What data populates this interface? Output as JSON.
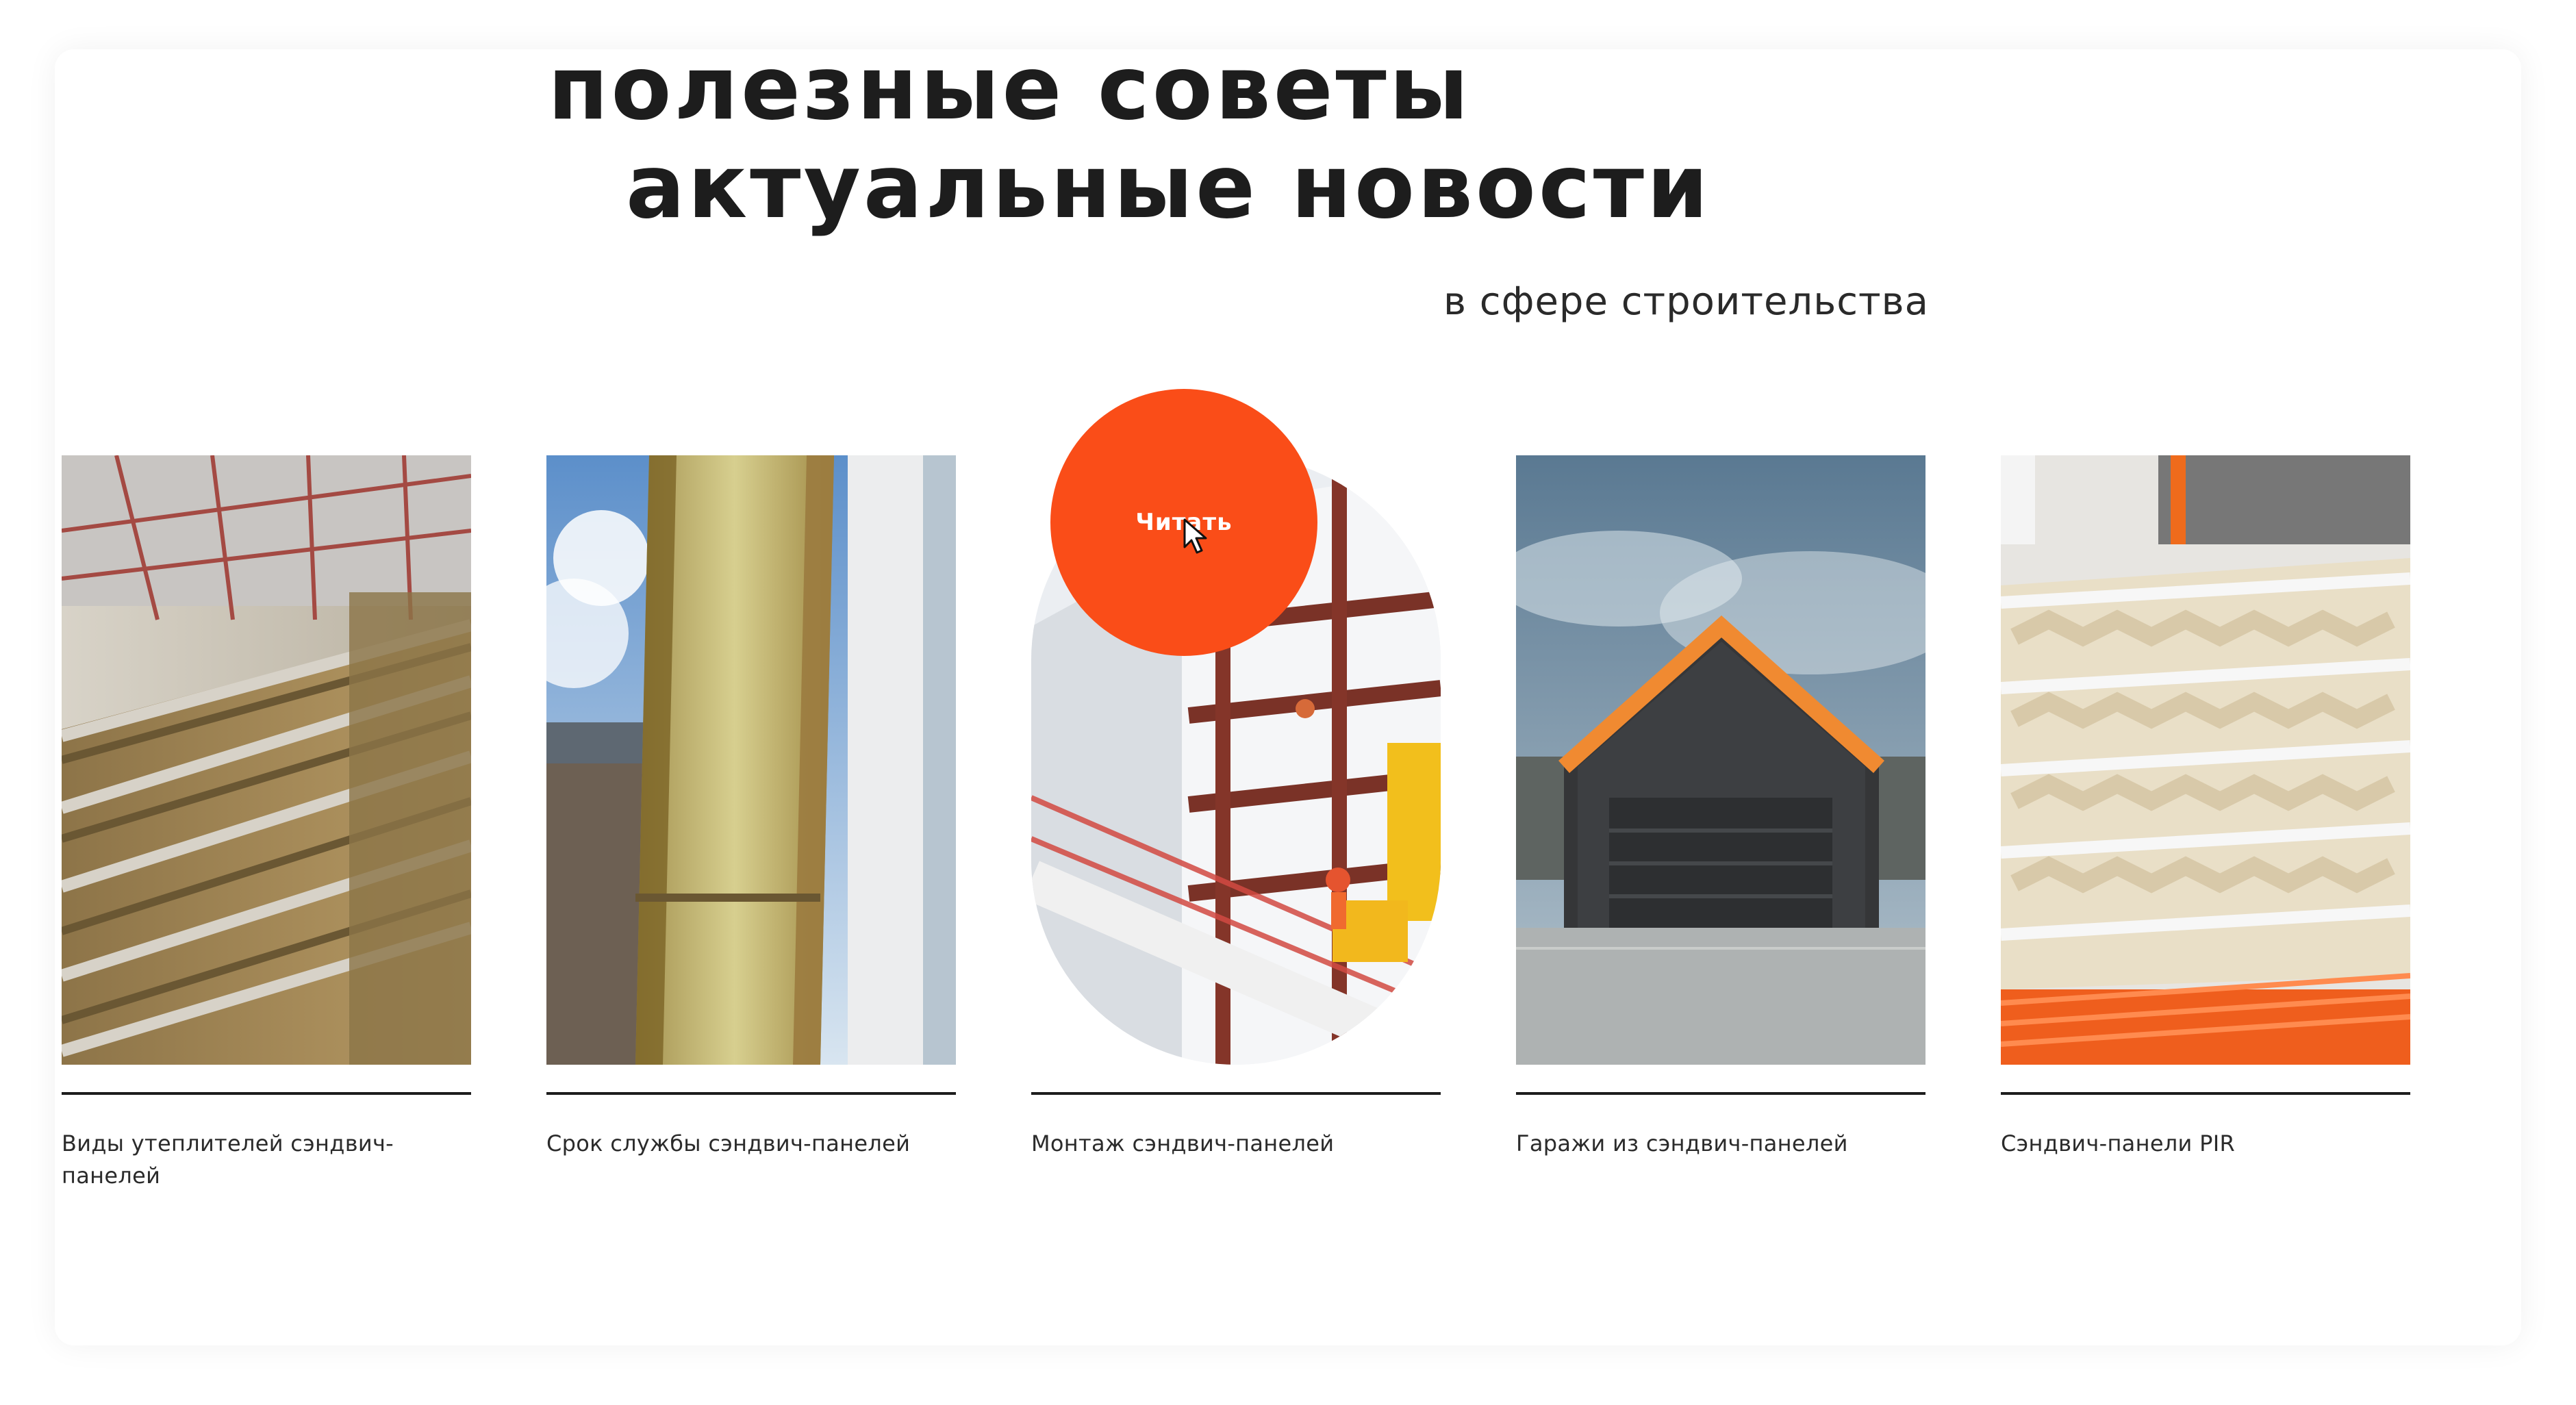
{
  "heading": {
    "line1": "полезные советы",
    "line2": "актуальные новости",
    "subtitle": "в сфере строительства"
  },
  "articles": [
    {
      "title": "Виды утеплителей сэндвич-панелей"
    },
    {
      "title": "Срок службы сэндвич-панелей"
    },
    {
      "title": "Монтаж сэндвич-панелей"
    },
    {
      "title": "Гаражи из сэндвич-панелей"
    },
    {
      "title": "Сэндвич-панели PIR"
    }
  ],
  "read_button": {
    "label": "Читать"
  },
  "colors": {
    "accent": "#fa4d18",
    "text": "#1d1d1d"
  },
  "icons": [
    "cursor-icon"
  ]
}
